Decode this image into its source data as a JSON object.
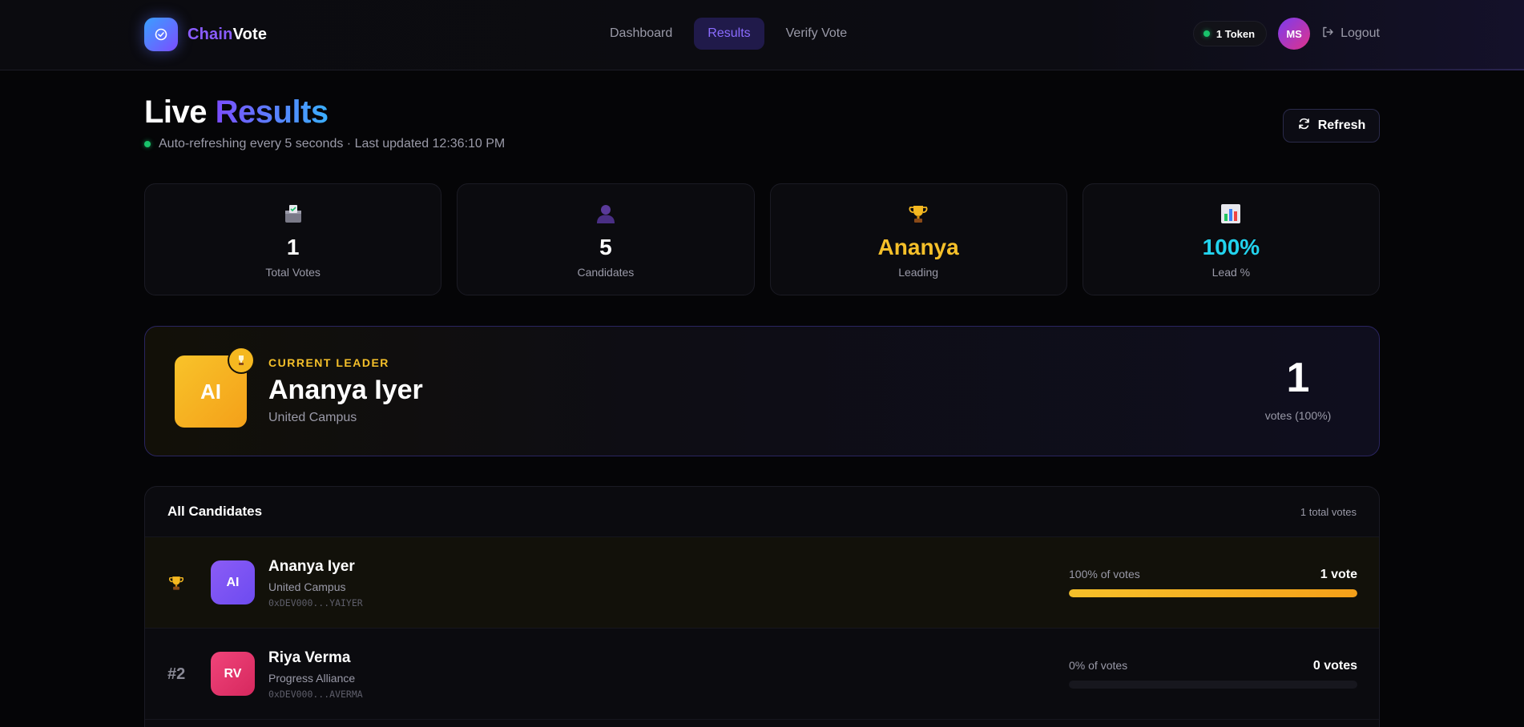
{
  "brand": {
    "part1": "Chain",
    "part2": "Vote"
  },
  "nav": [
    {
      "label": "Dashboard",
      "active": false
    },
    {
      "label": "Results",
      "active": true
    },
    {
      "label": "Verify Vote",
      "active": false
    }
  ],
  "header": {
    "token": "1 Token",
    "avatar": "MS",
    "logout": "Logout"
  },
  "page": {
    "title1": "Live",
    "title2": "Results",
    "subtitle": "Auto-refreshing every 5 seconds · Last updated 12:36:10 PM",
    "refresh": "Refresh"
  },
  "stats": [
    {
      "icon": "ballot-box-icon",
      "value": "1",
      "label": "Total Votes"
    },
    {
      "icon": "person-icon",
      "value": "5",
      "label": "Candidates"
    },
    {
      "icon": "trophy-icon",
      "value": "Ananya",
      "label": "Leading"
    },
    {
      "icon": "bar-chart-icon",
      "value": "100%",
      "label": "Lead %"
    }
  ],
  "leader": {
    "eyebrow": "CURRENT LEADER",
    "initials": "AI",
    "name": "Ananya Iyer",
    "party": "United Campus",
    "votes": "1",
    "votes_label": "votes (100%)"
  },
  "list": {
    "title": "All Candidates",
    "total": "1 total votes",
    "rows": [
      {
        "rank": "",
        "initials": "AI",
        "name": "Ananya Iyer",
        "party": "United Campus",
        "address": "0xDEV000...YAIYER",
        "pct_label": "100% of votes",
        "votes": "1 vote",
        "share": 1.0,
        "color_from": "#8b5cf6",
        "color_to": "#6d4bf0"
      },
      {
        "rank": "#2",
        "initials": "RV",
        "name": "Riya Verma",
        "party": "Progress Alliance",
        "address": "0xDEV000...AVERMA",
        "pct_label": "0% of votes",
        "votes": "0 votes",
        "share": 0.0,
        "color_from": "#f0447a",
        "color_to": "#d6285e"
      }
    ]
  },
  "colors": {
    "accent": "#8b6cff",
    "gold": "#f5c02a",
    "cyan": "#22d3ee",
    "green": "#19c36b"
  }
}
